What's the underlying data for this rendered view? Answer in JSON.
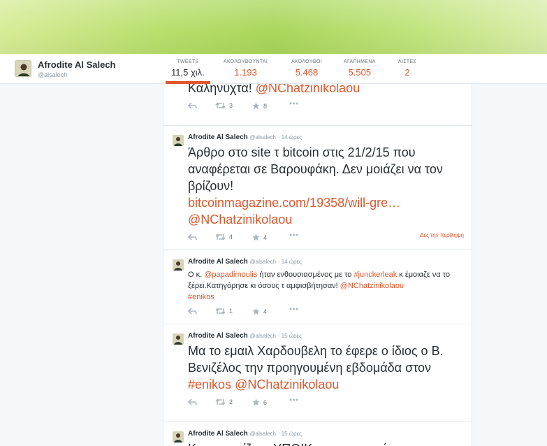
{
  "profile": {
    "name": "Afrodite Al Salech",
    "handle": "@alsalech"
  },
  "stats": [
    {
      "label": "TWEETS",
      "value": "11,5 χιλ."
    },
    {
      "label": "ΑΚΟΛΟΥΘΟΥΝΤΑΙ",
      "value": "1.193"
    },
    {
      "label": "ΑΚΟΛΟΥΘΟΙ",
      "value": "5.468"
    },
    {
      "label": "ΑΓΑΠΗΜΕΝΑ",
      "value": "5.505"
    },
    {
      "label": "ΛΙΣΤΕΣ",
      "value": "2"
    }
  ],
  "colors": {
    "accent": "#e0562c",
    "text": "#292f33",
    "muted": "#8899a6"
  },
  "tweets": [
    {
      "text_plain": "Καληνύχτα! ",
      "mention": "@NChatzinikolaou",
      "retweets": "3",
      "favorites": "8"
    },
    {
      "name": "Afrodite Al Salech",
      "handle": "@alsalech",
      "time": "· 14 ώρες",
      "text_plain": "Άρθρο στο site τ bitcoin στις 21/2/15 που αναφέρεται σε Βαρουφάκη. Δεν μοιάζει να τον βρίζουν!",
      "link": "bitcoinmagazine.com/19358/will-gre…",
      "mention": "@NChatzinikolaou",
      "retweets": "4",
      "favorites": "4",
      "summary_link": "Δες την περίληψη"
    },
    {
      "name": "Afrodite Al Salech",
      "handle": "@alsalech",
      "time": "· 14 ώρες",
      "t1": "Ο κ. ",
      "m1": "@papadimoulis",
      "t2": " ήταν ενθουσιασμένος με το ",
      "h1": "#junckerleak",
      "t3": " κ έμοιαζε να το ξέρει.Κατηγόρησε κι όσους τ αμφισβήτησαν! ",
      "m2": "@NChatzinikolaou",
      "h2": "#enikos",
      "retweets": "1",
      "favorites": "4"
    },
    {
      "name": "Afrodite Al Salech",
      "handle": "@alsalech",
      "time": "· 15 ώρες",
      "text_plain": "Μα το  εμαιλ Χαρδουβελη το έφερε ο ίδιος ο Β. Βενιζέλος την προηγουμένη εβδομάδα στον ",
      "hashtag": "#enikos",
      "mention": "@NChatzinikolaou",
      "retweets": "2",
      "favorites": "6"
    },
    {
      "name": "Afrodite Al Salech",
      "handle": "@alsalech",
      "time": "· 15 ώρες",
      "text_plain": "Και συνεχίζει ο ΥΠΟΙΚ να υπονομεύει τη"
    }
  ]
}
